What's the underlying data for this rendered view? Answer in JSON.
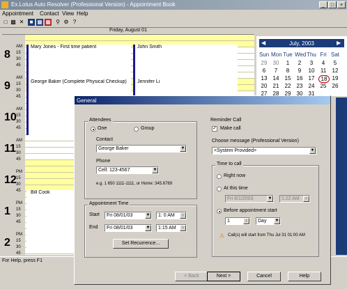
{
  "window": {
    "title": "Ex.Lotus Auto Resolver (Professional Version) - Appointment Book",
    "min": "_",
    "max": "□",
    "close": "×"
  },
  "menu": [
    "Appointment",
    "Contact",
    "View",
    "Help"
  ],
  "toolbar_icons": [
    "new-icon",
    "print-icon",
    "delete-icon",
    "day-view-icon",
    "week-view-icon",
    "month-view-icon",
    "find-icon",
    "options-icon",
    "help-icon"
  ],
  "day_header": "Friday, August 01",
  "hours": [
    "8",
    "9",
    "10",
    "11",
    "12",
    "1",
    "2"
  ],
  "ampm": [
    "AM",
    "AM",
    "AM",
    "AM",
    "PM",
    "PM",
    "PM"
  ],
  "minute_marks": [
    "15",
    "30",
    "45"
  ],
  "appointments": [
    {
      "text": "Mary Jones - First time patient"
    },
    {
      "text": "John Smith"
    },
    {
      "text": "George Baker (Complete Physical Checkup)"
    },
    {
      "text": "Jennifer Li"
    },
    {
      "text": "Bill Cook"
    }
  ],
  "minical": {
    "month": "July, 2003",
    "weekdays": [
      "Sun",
      "Mon",
      "Tue",
      "Wed",
      "Thu",
      "Fri",
      "Sat"
    ],
    "days": [
      [
        "29",
        "30",
        "1",
        "2",
        "3",
        "4",
        "5"
      ],
      [
        "6",
        "7",
        "8",
        "9",
        "10",
        "11",
        "12"
      ],
      [
        "13",
        "14",
        "15",
        "16",
        "17",
        "18",
        "19"
      ],
      [
        "20",
        "21",
        "22",
        "23",
        "24",
        "25",
        "26"
      ],
      [
        "27",
        "28",
        "29",
        "30",
        "31",
        "",
        ""
      ]
    ],
    "circled_day": "18"
  },
  "status": "For Help, press F1",
  "dialog": {
    "title": "General",
    "attendees": {
      "group_label": "Attendees",
      "one": "One",
      "group": "Group",
      "contact_label": "Contact",
      "contact_value": "George Baker",
      "phone_label": "Phone",
      "phone_value": "Cell: 123-4567",
      "example": "e.g. 1 650 1111-1111, or Home: 345.6789"
    },
    "appointment_time": {
      "group_label": "Appointment Time",
      "start_label": "Start",
      "end_label": "End",
      "start_date": "Fri 08/01/03",
      "start_time": "1: 0 AM",
      "end_date": "Fri 08/01/03",
      "end_time": "1:15 AM",
      "recurrence_button": "Set Recurrence..."
    },
    "reminder": {
      "group_label": "Reminder Call",
      "make_call": "Make call",
      "choose_message": "Choose message (Professional Version)",
      "message_value": "<System Provided>",
      "time_to_call": "Time to call",
      "right_now": "Right now",
      "at_this_time": "At this time",
      "at_date": "Fri 8/1/2003",
      "at_time": "1:22 AM",
      "before_start": "Before appointment start",
      "before_amount": "1",
      "before_unit": "Day",
      "call_note": "Call(s) will start from Thu Jul 31 01:00 AM"
    },
    "buttons": {
      "back": "< Back",
      "next": "Next >",
      "cancel": "Cancel",
      "help": "Help"
    }
  }
}
